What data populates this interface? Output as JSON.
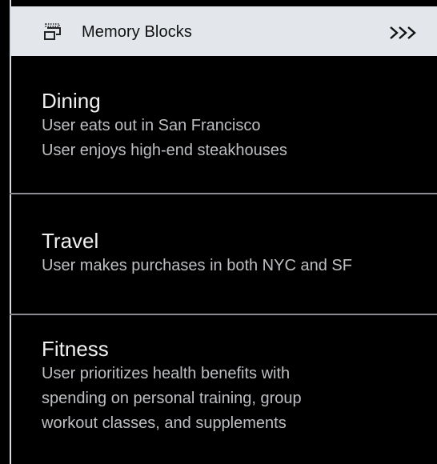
{
  "header": {
    "title": "Memory Blocks",
    "icon": "memory-blocks-icon",
    "expand_icon": "triple-chevron-right-icon"
  },
  "blocks": [
    {
      "title": "Dining",
      "lines": [
        "User eats out in San Francisco",
        "User enjoys high-end steakhouses"
      ]
    },
    {
      "title": "Travel",
      "lines": [
        "User makes purchases in both NYC and SF"
      ]
    },
    {
      "title": "Fitness",
      "lines": [
        "User prioritizes health benefits with",
        "spending on personal training, group",
        "workout classes, and supplements"
      ]
    }
  ],
  "colors": {
    "background": "#000000",
    "header_background": "#e3e6ea",
    "title_text": "#f1f1f1",
    "body_text": "#bdbfc3",
    "divider": "#8a8c90"
  }
}
